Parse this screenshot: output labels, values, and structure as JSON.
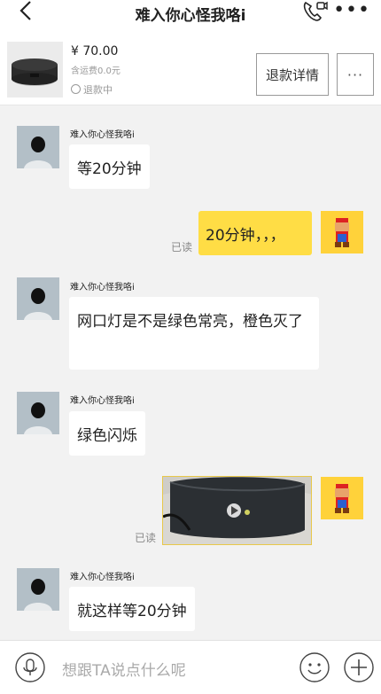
{
  "header": {
    "title": "难入你心怪我咯i",
    "icons": [
      "back-icon",
      "phone-video-icon",
      "more-icon"
    ],
    "more_glyph": "•••"
  },
  "product": {
    "price": "¥ 70.00",
    "shipping": "含运费0.0元",
    "status": "退款中",
    "refund_button": "退款详情",
    "more_button": "···"
  },
  "chat": {
    "messages": [
      {
        "from": "other",
        "sender": "难入你心怪我咯i",
        "text": "等20分钟"
      },
      {
        "from": "me",
        "read": "已读",
        "text": "20分钟，，，"
      },
      {
        "from": "other",
        "sender": "难入你心怪我咯i",
        "text": "网口灯是不是绿色常亮，橙色灭了"
      },
      {
        "from": "other",
        "sender": "难入你心怪我咯i",
        "text": "绿色闪烁"
      },
      {
        "from": "me",
        "read": "已读",
        "type": "video"
      },
      {
        "from": "other",
        "sender": "难入你心怪我咯i",
        "text": "就这样等20分钟"
      }
    ]
  },
  "input": {
    "placeholder": "想跟TA说点什么呢",
    "icons": [
      "mic-icon",
      "emoji-icon",
      "plus-icon"
    ]
  },
  "colors": {
    "my_bubble": "#ffdd45",
    "background": "#f2f2f2"
  }
}
